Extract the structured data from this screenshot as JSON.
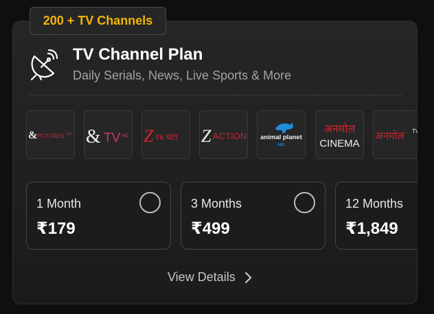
{
  "badge": {
    "label": "200 + TV Channels"
  },
  "plan_card": {
    "title": "TV Channel Plan",
    "subtitle": "Daily Serials, News, Live Sports & More",
    "icon": "satellite-dish-icon"
  },
  "channels": [
    {
      "name": "&Pictures HD",
      "line1": "&",
      "line2": "PICTURES",
      "hd": "HD"
    },
    {
      "name": "&TV HD",
      "line1": "&",
      "line2": "TV",
      "hd": "HD"
    },
    {
      "name": "Zee 24 Ghanta",
      "line1": "Z",
      "line2": "२४ घंटा"
    },
    {
      "name": "Zee Action",
      "line1": "Z",
      "line2": "ACTION"
    },
    {
      "name": "Animal Planet HD",
      "line1": "animal planet",
      "hd": "HD"
    },
    {
      "name": "Anmol Cinema",
      "line1": "अनमोल",
      "line2": "CINEMA"
    },
    {
      "name": "Anmol TV",
      "line1": "अनमोल",
      "line2": "TV"
    }
  ],
  "plans": [
    {
      "duration": "1 Month",
      "price": "₹179"
    },
    {
      "duration": "3 Months",
      "price": "₹499"
    },
    {
      "duration": "12 Months",
      "price": "₹1,849"
    }
  ],
  "footer": {
    "view_details": "View Details"
  }
}
